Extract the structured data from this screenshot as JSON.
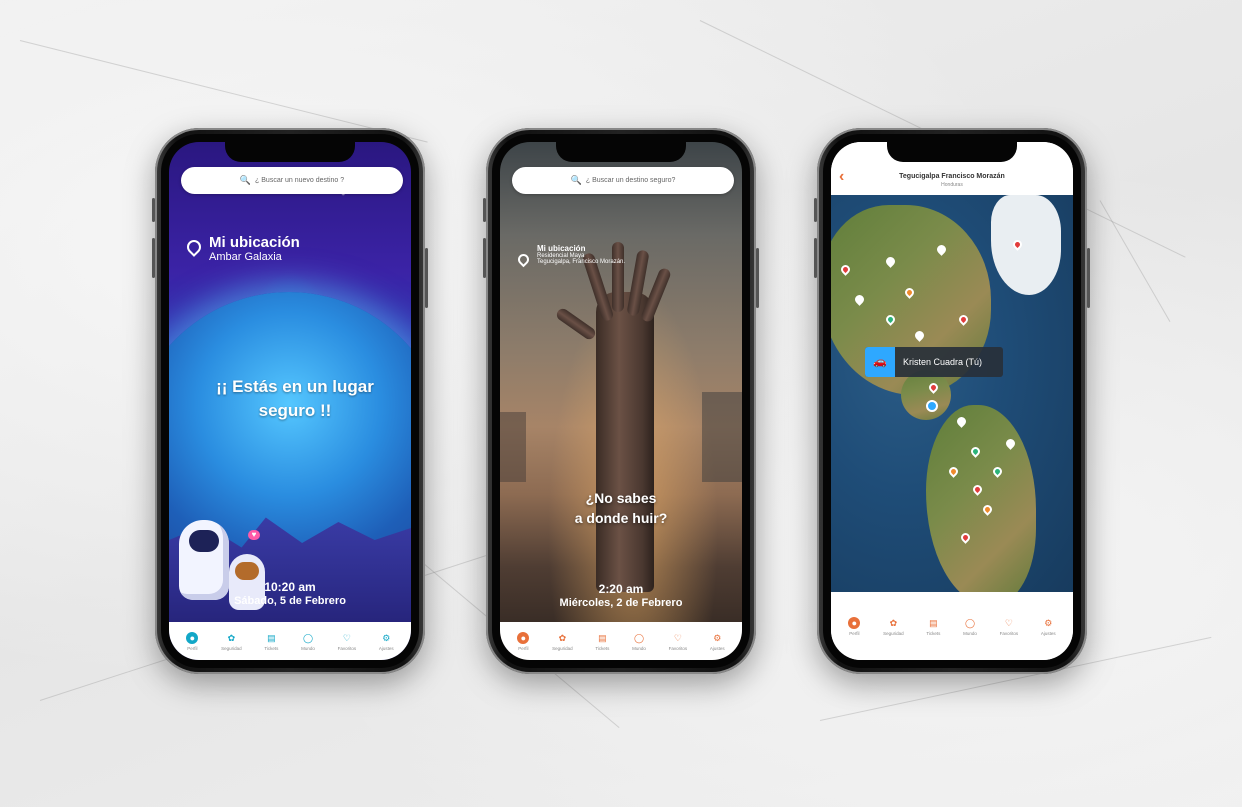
{
  "colors": {
    "teal": "#12a7c7",
    "orange": "#e8703a",
    "blue_accent": "#2ea8ff",
    "map_pin_red": "#e23c3c",
    "map_pin_green": "#2bb37a",
    "map_pin_orange": "#f08a2c",
    "map_pin_white": "#ffffff"
  },
  "phone1": {
    "search_placeholder": "¿ Buscar un nuevo destino ?",
    "location_title": "Mi ubicación",
    "location_sub": "Ambar Galaxia",
    "message": "¡¡ Estás en un lugar seguro !!",
    "time": "10:20 am",
    "date": "Sábado, 5 de Febrero",
    "nav": [
      {
        "label": "Perfil",
        "icon": "person-icon"
      },
      {
        "label": "Seguridad",
        "icon": "fingerprint-icon"
      },
      {
        "label": "Tickets",
        "icon": "ticket-icon"
      },
      {
        "label": "Mundo",
        "icon": "globe-icon"
      },
      {
        "label": "Favoritos",
        "icon": "heart-icon"
      },
      {
        "label": "Ajustes",
        "icon": "gear-icon"
      }
    ]
  },
  "phone2": {
    "search_placeholder": "¿ Buscar un destino seguro?",
    "location_title": "Mi ubicación",
    "location_line1": "Residencial Maya",
    "location_line2": "Tegucigalpa, Francisco Morazán.",
    "message_line1": "¿No sabes",
    "message_line2": "a donde huir?",
    "time": "2:20 am",
    "date": "Miércoles, 2 de Febrero",
    "nav": [
      {
        "label": "Perfil",
        "icon": "person-icon"
      },
      {
        "label": "Seguridad",
        "icon": "fingerprint-icon"
      },
      {
        "label": "Tickets",
        "icon": "ticket-icon"
      },
      {
        "label": "Mundo",
        "icon": "globe-icon"
      },
      {
        "label": "Favoritos",
        "icon": "heart-icon"
      },
      {
        "label": "Ajustes",
        "icon": "gear-icon"
      }
    ]
  },
  "phone3": {
    "title": "Tegucigalpa Francisco Morazán",
    "subtitle": "Honduras",
    "back_icon": "chevron-left-icon",
    "user_tooltip": "Kristen Cuadra (Tú)",
    "user_icon": "car-icon",
    "nav": [
      {
        "label": "Perfil",
        "icon": "person-icon"
      },
      {
        "label": "Seguridad",
        "icon": "fingerprint-icon"
      },
      {
        "label": "Tickets",
        "icon": "ticket-icon"
      },
      {
        "label": "Mundo",
        "icon": "globe-icon"
      },
      {
        "label": "Favoritos",
        "icon": "heart-icon"
      },
      {
        "label": "Ajustes",
        "icon": "gear-icon"
      }
    ]
  }
}
